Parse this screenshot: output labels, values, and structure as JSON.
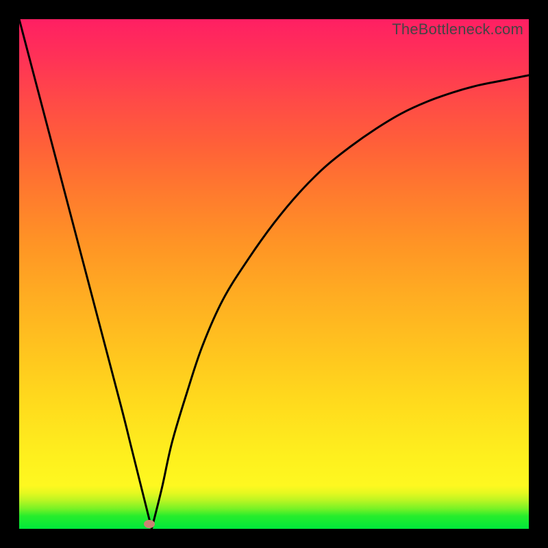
{
  "watermark": "TheBottleneck.com",
  "chart_data": {
    "type": "line",
    "title": "",
    "xlabel": "",
    "ylabel": "",
    "xlim": [
      0,
      100
    ],
    "ylim": [
      0,
      100
    ],
    "grid": false,
    "series": [
      {
        "name": "bottleneck-curve",
        "x": [
          0,
          5,
          10,
          15,
          20,
          22,
          24,
          25,
          26,
          28,
          30,
          33,
          36,
          40,
          45,
          50,
          55,
          60,
          65,
          70,
          75,
          80,
          85,
          90,
          95,
          100
        ],
        "values": [
          100,
          81,
          62,
          43,
          24,
          16,
          8,
          4,
          0,
          8,
          17,
          27,
          36,
          45,
          53,
          60,
          66,
          71,
          75,
          78.5,
          81.5,
          83.8,
          85.6,
          87,
          88,
          89
        ]
      }
    ],
    "marker": {
      "x": 25.5,
      "y": 1,
      "color": "#cd8273"
    },
    "gradient_stops": [
      {
        "pct": 0,
        "color": "#00e83b"
      },
      {
        "pct": 8,
        "color": "#fef820"
      },
      {
        "pct": 50,
        "color": "#ffa023"
      },
      {
        "pct": 100,
        "color": "#ff1f63"
      }
    ]
  }
}
